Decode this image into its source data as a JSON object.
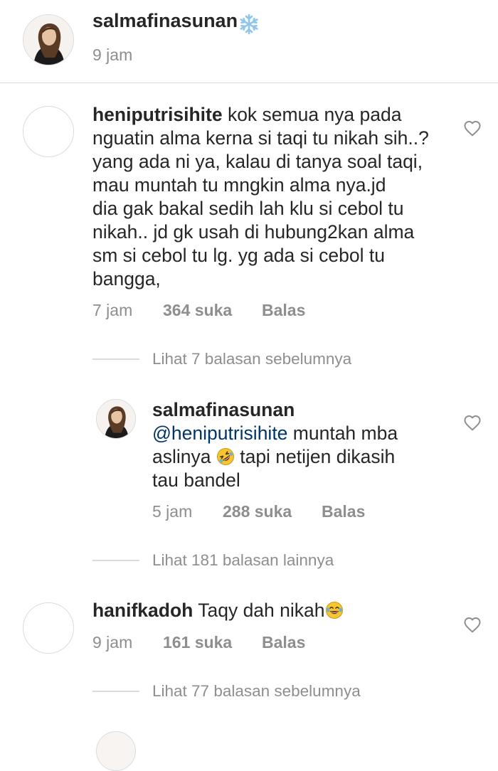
{
  "caption": {
    "username": "salmafinasunan",
    "time": "9 jam",
    "badge_icon": "snowflake-icon"
  },
  "comments": [
    {
      "username": "heniputrisihite",
      "text_lines": [
        " kok semua nya pada",
        "nguatin alma kerna si taqi tu nikah sih..?",
        "yang ada ni ya, kalau di tanya soal taqi,",
        "mau muntah tu mngkin alma nya.jd",
        "dia gak bakal sedih lah klu si cebol tu",
        "nikah.. jd gk usah di hubung2kan alma",
        "sm si cebol tu lg. yg ada si cebol tu",
        "bangga,"
      ],
      "time": "7 jam",
      "likes": "364 suka",
      "reply": "Balas",
      "view_replies": "Lihat 7 balasan sebelumnya"
    },
    {
      "username": "salmafinasunan",
      "mention": "@heniputrisihite",
      "text_line1_rest": " muntah mba",
      "text_line2_a": "aslinya ",
      "text_line2_b": " tapi netijen dikasih",
      "text_line3": "tau bandel",
      "emoji_icon": "rofl-emoji",
      "time": "5 jam",
      "likes": "288 suka",
      "reply": "Balas",
      "view_replies": "Lihat 181 balasan lainnya"
    },
    {
      "username": "hanifkadoh",
      "text": " Taqy dah nikah",
      "emoji_icon": "joy-emoji",
      "time": "9 jam",
      "likes": "161 suka",
      "reply": "Balas",
      "view_replies": "Lihat 77 balasan sebelumnya"
    }
  ],
  "colors": {
    "text": "#262626",
    "secondary": "#8e8e8e",
    "mention": "#003569",
    "divider": "#dbdbdb"
  }
}
